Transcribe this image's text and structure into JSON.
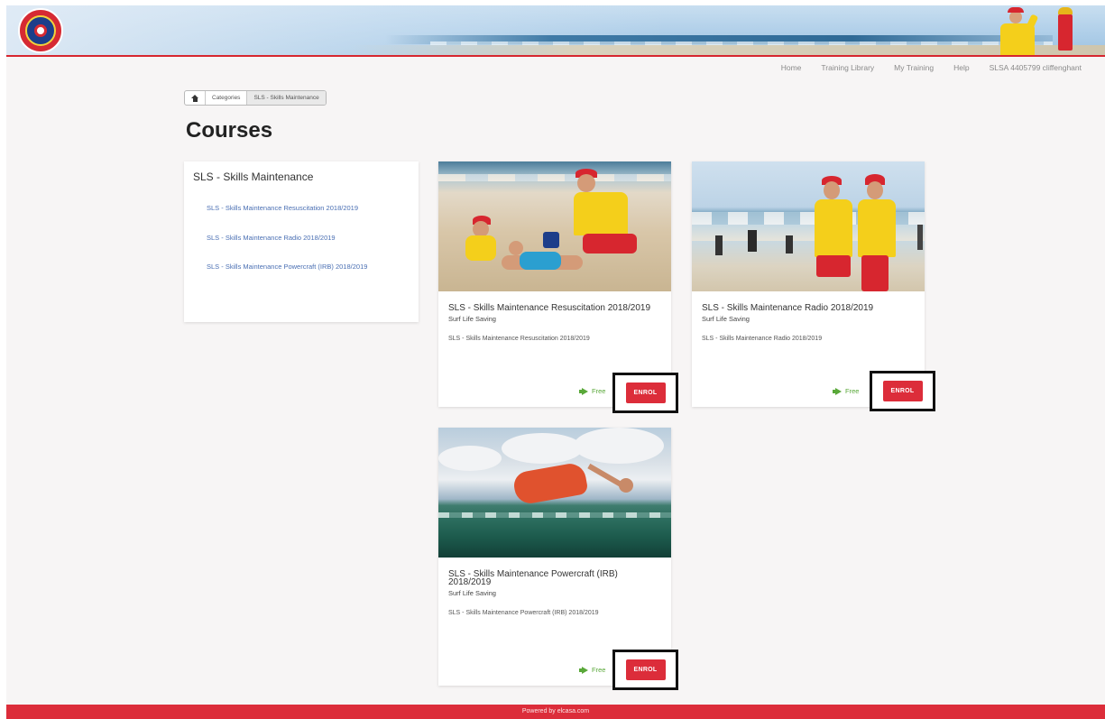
{
  "header": {
    "logo_icon": "surf-life-saving-logo-icon",
    "nav": [
      "Home",
      "Training Library",
      "My Training",
      "Help",
      "SLSA 4405799 cliffenghant"
    ]
  },
  "breadcrumb": {
    "home_icon": "home-icon",
    "items": [
      "Categories",
      "SLS - Skills Maintenance"
    ]
  },
  "page": {
    "title": "Courses"
  },
  "sidebar": {
    "title": "SLS - Skills Maintenance",
    "items": [
      "SLS - Skills Maintenance Resuscitation 2018/2019",
      "SLS - Skills Maintenance Radio 2018/2019",
      "SLS - Skills Maintenance Powercraft (IRB) 2018/2019"
    ]
  },
  "courses": [
    {
      "title": "SLS - Skills Maintenance Resuscitation 2018/2019",
      "org": "Surf Life Saving",
      "description": "SLS - Skills Maintenance Resuscitation 2018/2019",
      "price": "Free",
      "enrol_label": "ENROL"
    },
    {
      "title": "SLS - Skills Maintenance Radio 2018/2019",
      "org": "Surf Life Saving",
      "description": "SLS - Skills Maintenance Radio 2018/2019",
      "price": "Free",
      "enrol_label": "ENROL"
    },
    {
      "title": "SLS - Skills Maintenance Powercraft (IRB) 2018/2019",
      "org": "Surf Life Saving",
      "description": "SLS - Skills Maintenance Powercraft (IRB) 2018/2019",
      "price": "Free",
      "enrol_label": "ENROL"
    }
  ],
  "footer": {
    "text": "Powered by elcasa.com"
  },
  "colors": {
    "brand_red": "#dc2d3a",
    "link_blue": "#4a6fb3",
    "free_green": "#59a839"
  }
}
